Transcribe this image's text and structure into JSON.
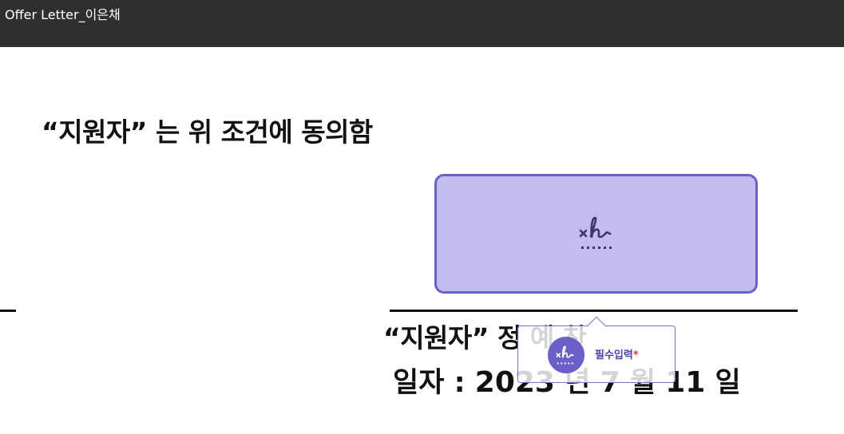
{
  "window": {
    "title": "Offer Letter_이은채"
  },
  "document": {
    "agreement_statement": "“지원자” 는 위 조건에 동의함",
    "applicant_prefix": "“지원자”",
    "applicant_name": "정 예 찬",
    "date": {
      "label": "일자 :",
      "year": "2023",
      "year_unit": "년",
      "month": "7",
      "month_unit": "월",
      "day": "11",
      "day_unit": "일"
    }
  },
  "signature_field": {
    "icon": "signature-icon",
    "fill_color": "#c3bdee",
    "border_color": "#6c5fc7"
  },
  "tooltip": {
    "icon": "signature-icon",
    "label": "필수입력",
    "required_mark": "*"
  },
  "colors": {
    "topbar": "#2f2f2f",
    "accent": "#6c5fc7",
    "required": "#e03a3a"
  }
}
